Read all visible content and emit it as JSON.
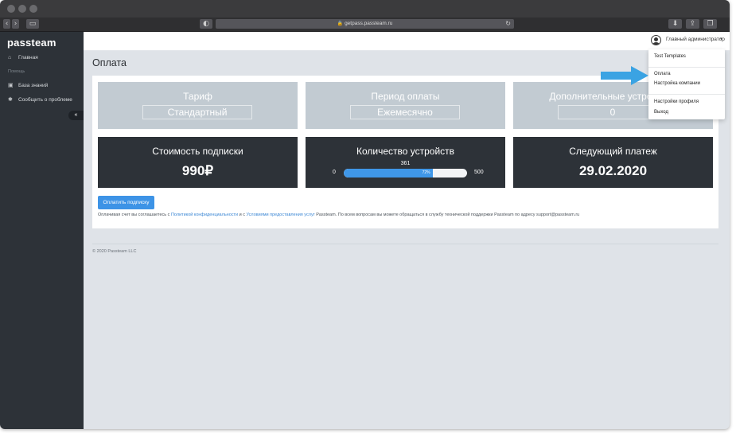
{
  "browser": {
    "url": "getpass.passteam.ru",
    "back_icon": "chevron-left-icon",
    "forward_icon": "chevron-right-icon"
  },
  "sidebar": {
    "logo": "passteam",
    "items": [
      {
        "label": "Главная",
        "icon": "home-icon"
      },
      {
        "label": "База знаний",
        "icon": "book-icon"
      },
      {
        "label": "Сообщить о проблеме",
        "icon": "bug-icon"
      }
    ],
    "section": "Помощь",
    "collapse_glyph": "«"
  },
  "header": {
    "user_name": "Главный администратор",
    "caret": "▾"
  },
  "dropdown": {
    "items": [
      "Test Templates",
      "Оплата",
      "Настройка компании",
      "Настройки профиля",
      "Выход"
    ]
  },
  "page": {
    "title": "Оплата",
    "tiles_top": [
      {
        "title": "Тариф",
        "value": "Стандартный"
      },
      {
        "title": "Период оплаты",
        "value": "Ежемесячно"
      },
      {
        "title": "Дополнительные устройства",
        "value": "0"
      }
    ],
    "subscription": {
      "title": "Стоимость подписки",
      "value": "990₽"
    },
    "devices": {
      "title": "Количество устройств",
      "current": "361",
      "min": "0",
      "max": "500",
      "percent_label": "72%",
      "fraction": 0.72
    },
    "next_payment": {
      "title": "Следующий платеж",
      "value": "29.02.2020"
    },
    "pay_button": "Оплатить подписку",
    "terms": {
      "part1": "Оплачивая счет вы соглашаетесь с ",
      "link1": "Политикой конфиденциальности",
      "part2": " и с ",
      "link2": "Условиями предоставления услуг",
      "part3": " Passteam. По всем вопросам вы можете обращаться в службу технической поддержки Passteam по адресу support@passteam.ru"
    }
  },
  "footer": {
    "copyright": "© 2020 Passteam LLC"
  },
  "colors": {
    "accent": "#3d93e6",
    "sidebar": "#2d3238",
    "tile_light": "#c2cbd2",
    "tile_dark": "#2d3238",
    "arrow": "#3aa3e3"
  }
}
